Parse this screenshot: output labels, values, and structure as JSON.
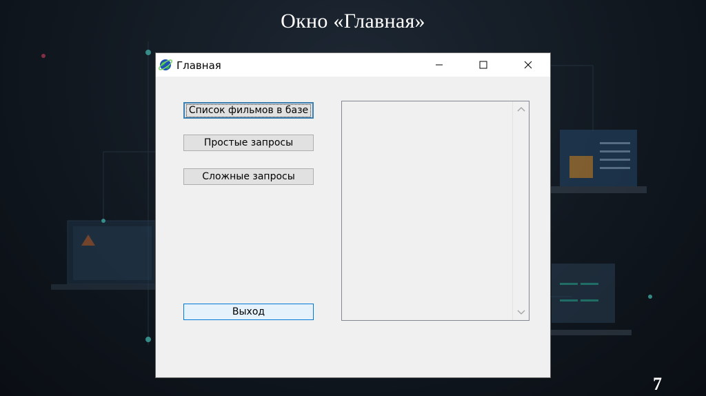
{
  "slide": {
    "title": "Окно «Главная»",
    "page_number": "7"
  },
  "window": {
    "title": "Главная",
    "icon": "globe-app-icon",
    "controls": [
      "minimize-icon",
      "maximize-icon",
      "close-icon"
    ]
  },
  "buttons": {
    "film_list": "Список фильмов в базе",
    "simple_queries": "Простые запросы",
    "complex_queries": "Сложные запросы",
    "exit": "Выход"
  },
  "listbox": {
    "items": []
  },
  "colors": {
    "focus_border": "#3c7fb1",
    "hover_background": "#e5f1fb",
    "hover_border": "#0078d7"
  }
}
